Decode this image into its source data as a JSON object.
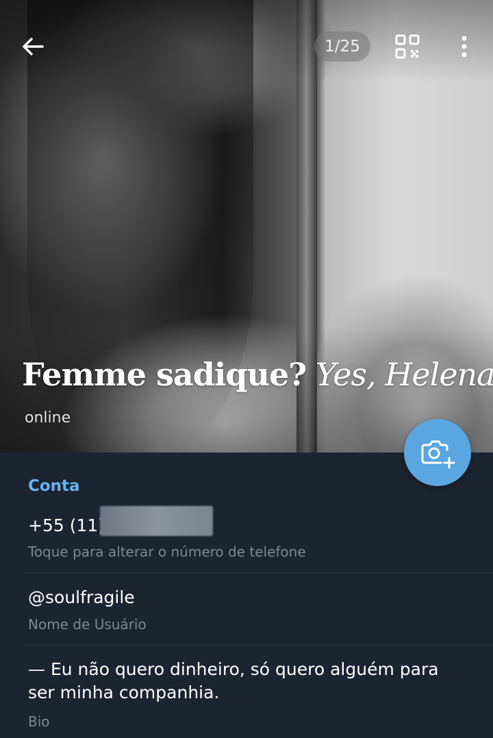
{
  "header": {
    "photo_counter": "1/25",
    "name_bold": "Femme sadique?",
    "name_italic": "Yes, Helena",
    "name_end": "!",
    "status": "online",
    "icons": [
      "back-arrow-icon",
      "qr-code-icon",
      "more-vertical-icon",
      "add-photo-icon"
    ]
  },
  "account": {
    "section_title": "Conta",
    "phone": "+55 (11) ",
    "phone_hint": "Toque para alterar o número de telefone",
    "username": "@soulfragile",
    "username_hint": "Nome de Usuário",
    "bio_line1": "— Eu não quero dinheiro, só quero alguém para",
    "bio_line2": "ser minha companhia.",
    "bio_hint": "Bio"
  },
  "colors": {
    "accent": "#66b4f0",
    "fab": "#5aa6e0",
    "background": "#1c2431"
  }
}
